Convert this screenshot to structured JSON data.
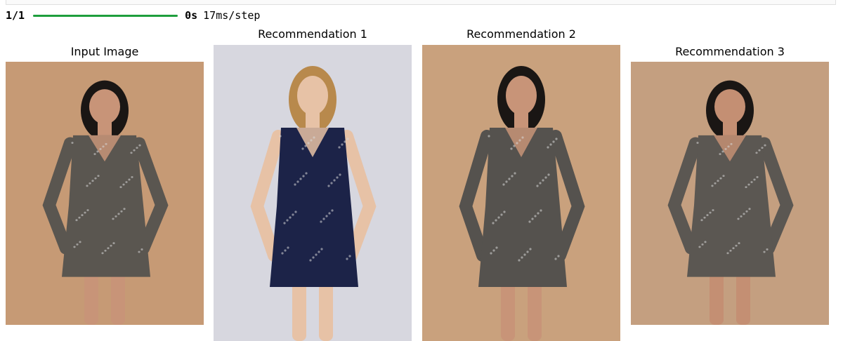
{
  "progress": {
    "step_count": "1/1",
    "fraction_complete": 1.0,
    "eta": "0s",
    "speed": "17ms/step",
    "bar_color": "#1e9e3d"
  },
  "panels": [
    {
      "title": "Input Image",
      "background": "#c69a75",
      "dress_color": "#5a5650",
      "hair_color": "#1a1614",
      "skin_color": "#c89478"
    },
    {
      "title": "Recommendation 1",
      "background": "#d7d7df",
      "dress_color": "#1c2348",
      "hair_color": "#b8894c",
      "skin_color": "#e7c2a6"
    },
    {
      "title": "Recommendation 2",
      "background": "#c9a17d",
      "dress_color": "#55524e",
      "hair_color": "#1a1614",
      "skin_color": "#c89478"
    },
    {
      "title": "Recommendation 3",
      "background": "#c49f80",
      "dress_color": "#5b5752",
      "hair_color": "#1a1614",
      "skin_color": "#c48f73"
    }
  ]
}
